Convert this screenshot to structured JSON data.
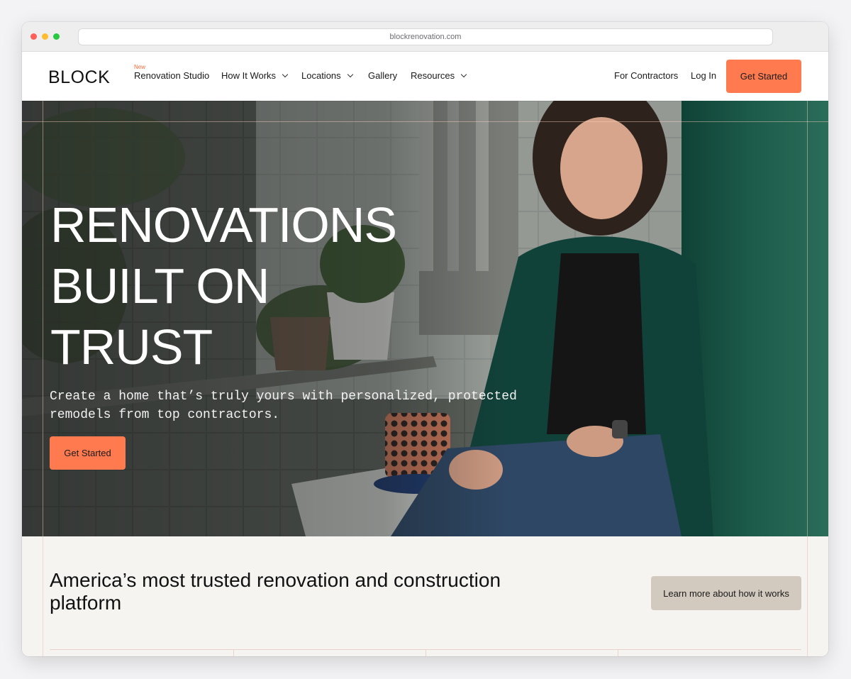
{
  "browser": {
    "url": "blockrenovation.com"
  },
  "nav": {
    "logo": "BLOCK",
    "new_badge": "New",
    "items": [
      {
        "label": "Renovation Studio",
        "dropdown": false
      },
      {
        "label": "How It Works",
        "dropdown": true
      },
      {
        "label": "Locations",
        "dropdown": true
      },
      {
        "label": "Gallery",
        "dropdown": false
      },
      {
        "label": "Resources",
        "dropdown": true
      }
    ],
    "for_contractors": "For Contractors",
    "log_in": "Log In",
    "get_started": "Get Started"
  },
  "hero": {
    "headline_lines": [
      "RENOVATIONS",
      "BUILT ON",
      "TRUST"
    ],
    "subtext": "Create a home that’s truly yours with personalized, protected remodels from top contractors.",
    "cta": "Get Started"
  },
  "section": {
    "tagline": "America’s most trusted renovation and construction platform",
    "learn_more": "Learn more about how it works"
  },
  "colors": {
    "accent": "#ff7b4f",
    "secondary_button": "#d2c9bf",
    "section_bg": "#f6f4f1"
  }
}
